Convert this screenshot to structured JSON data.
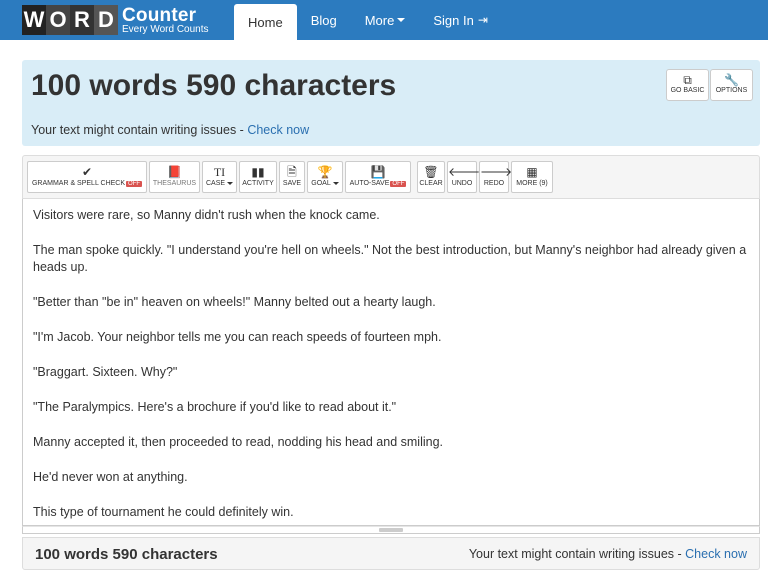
{
  "logo": {
    "letters": [
      "W",
      "O",
      "R",
      "D"
    ],
    "brand": "Counter",
    "tagline": "Every Word Counts"
  },
  "nav": {
    "home": "Home",
    "blog": "Blog",
    "more": "More",
    "signin": "Sign In"
  },
  "header": {
    "count_title": "100 words 590 characters",
    "issues_text": "Your text might contain writing issues - ",
    "issues_link": "Check now",
    "go_basic": "GO BASIC",
    "options": "OPTIONS"
  },
  "toolbar": {
    "grammar": "GRAMMAR & SPELL CHECK",
    "grammar_state": "OFF",
    "thesaurus": "THESAURUS",
    "case_icon": "TI",
    "case": "CASE",
    "activity": "ACTIVITY",
    "save": "SAVE",
    "goal": "GOAL",
    "autosave": "AUTO-SAVE",
    "autosave_state": "OFF",
    "clear": "CLEAR",
    "undo": "UNDO",
    "redo": "REDO",
    "more": "MORE (9)"
  },
  "text": {
    "paragraphs": [
      "Visitors were rare, so Manny didn't rush when the knock came.",
      "The man spoke quickly. \"I understand you're hell on wheels.\"  Not the best introduction, but Manny's neighbor had already given a heads up.",
      "\"Better than \"be in\" heaven on wheels!\" Manny belted out a hearty laugh.",
      "\"I'm Jacob. Your neighbor tells me you can reach speeds of fourteen mph.",
      "\"Braggart. Sixteen. Why?\"",
      "\"The Paralympics. Here's a brochure if you'd like to read about it.\"",
      "Manny accepted it, then proceeded to read, nodding his head and smiling.",
      "He'd never won at anything.",
      "This type of tournament he could definitely win."
    ]
  },
  "footer": {
    "count": "100 words 590 characters",
    "issues_text": "Your text might contain writing issues - ",
    "issues_link": "Check now"
  },
  "colors": {
    "navbar": "#2c7bbf",
    "header_bg": "#d9edf7",
    "link": "#2a6fb0",
    "off_badge": "#d9534f"
  }
}
